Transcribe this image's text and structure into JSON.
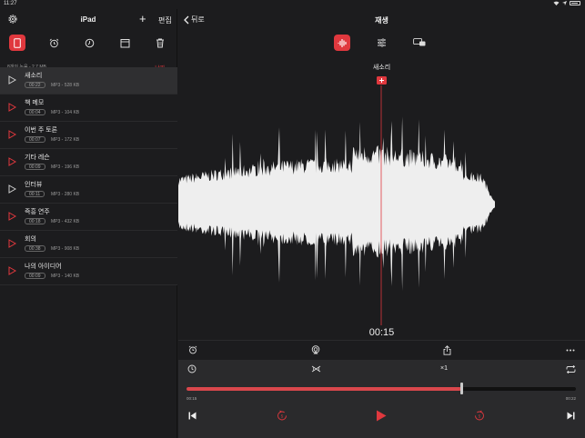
{
  "status": {
    "time": "11:27"
  },
  "sidebar": {
    "title": "iPad",
    "edit_label": "편집",
    "plus_label": "+",
    "count_text": "8개의 녹음 - 2.7 MB",
    "sort_label": "날짜 ▾",
    "recordings": [
      {
        "name": "새소리",
        "duration": "00:22",
        "info": "MP3 - 528 KB",
        "selected": true
      },
      {
        "name": "책 메모",
        "duration": "00:04",
        "info": "MP3 - 104 KB",
        "selected": false
      },
      {
        "name": "이번 주 토론",
        "duration": "00:07",
        "info": "MP3 - 172 KB",
        "selected": false
      },
      {
        "name": "기타 레슨",
        "duration": "00:09",
        "info": "MP3 - 196 KB",
        "selected": false
      },
      {
        "name": "인터뷰",
        "duration": "00:11",
        "info": "MP3 - 280 KB",
        "selected": false
      },
      {
        "name": "즉흥 연주",
        "duration": "00:18",
        "info": "MP3 - 432 KB",
        "selected": false
      },
      {
        "name": "회의",
        "duration": "00:38",
        "info": "MP3 - 908 KB",
        "selected": false
      },
      {
        "name": "나의 아이디어",
        "duration": "00:09",
        "info": "MP3 - 140 KB",
        "selected": false
      }
    ]
  },
  "main": {
    "back_label": "뒤로",
    "title": "재생",
    "recording_title": "새소리",
    "current_time": "00:15",
    "speed_label": "×1",
    "elapsed": "00:15",
    "total": "00:22",
    "progress": 0.705
  },
  "colors": {
    "accent": "#e0383e",
    "background": "#1c1c1e",
    "panel": "#2a2a2c"
  }
}
